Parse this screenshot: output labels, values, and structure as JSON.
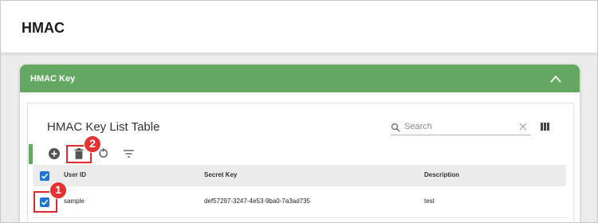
{
  "page": {
    "title": "HMAC"
  },
  "panel": {
    "title": "HMAC Key"
  },
  "card": {
    "title": "HMAC Key List Table",
    "search": {
      "placeholder": "Search",
      "value": ""
    }
  },
  "table": {
    "columns": [
      "User ID",
      "Secret Key",
      "Description"
    ],
    "rows": [
      {
        "user_id": "sample",
        "secret_key": "def57297-3247-4e53-9ba0-7a3ad735",
        "description": "test",
        "checked": true
      }
    ]
  },
  "annotations": {
    "marker_1": "1",
    "marker_2": "2"
  },
  "colors": {
    "accent": "#65a863",
    "checkbox": "#1f74d2",
    "marker": "#e23232"
  },
  "icons": [
    "collapse-up-icon",
    "search-icon",
    "clear-icon",
    "columns-icon",
    "add-icon",
    "delete-icon",
    "refresh-icon",
    "filter-icon",
    "checkmark-icon"
  ]
}
